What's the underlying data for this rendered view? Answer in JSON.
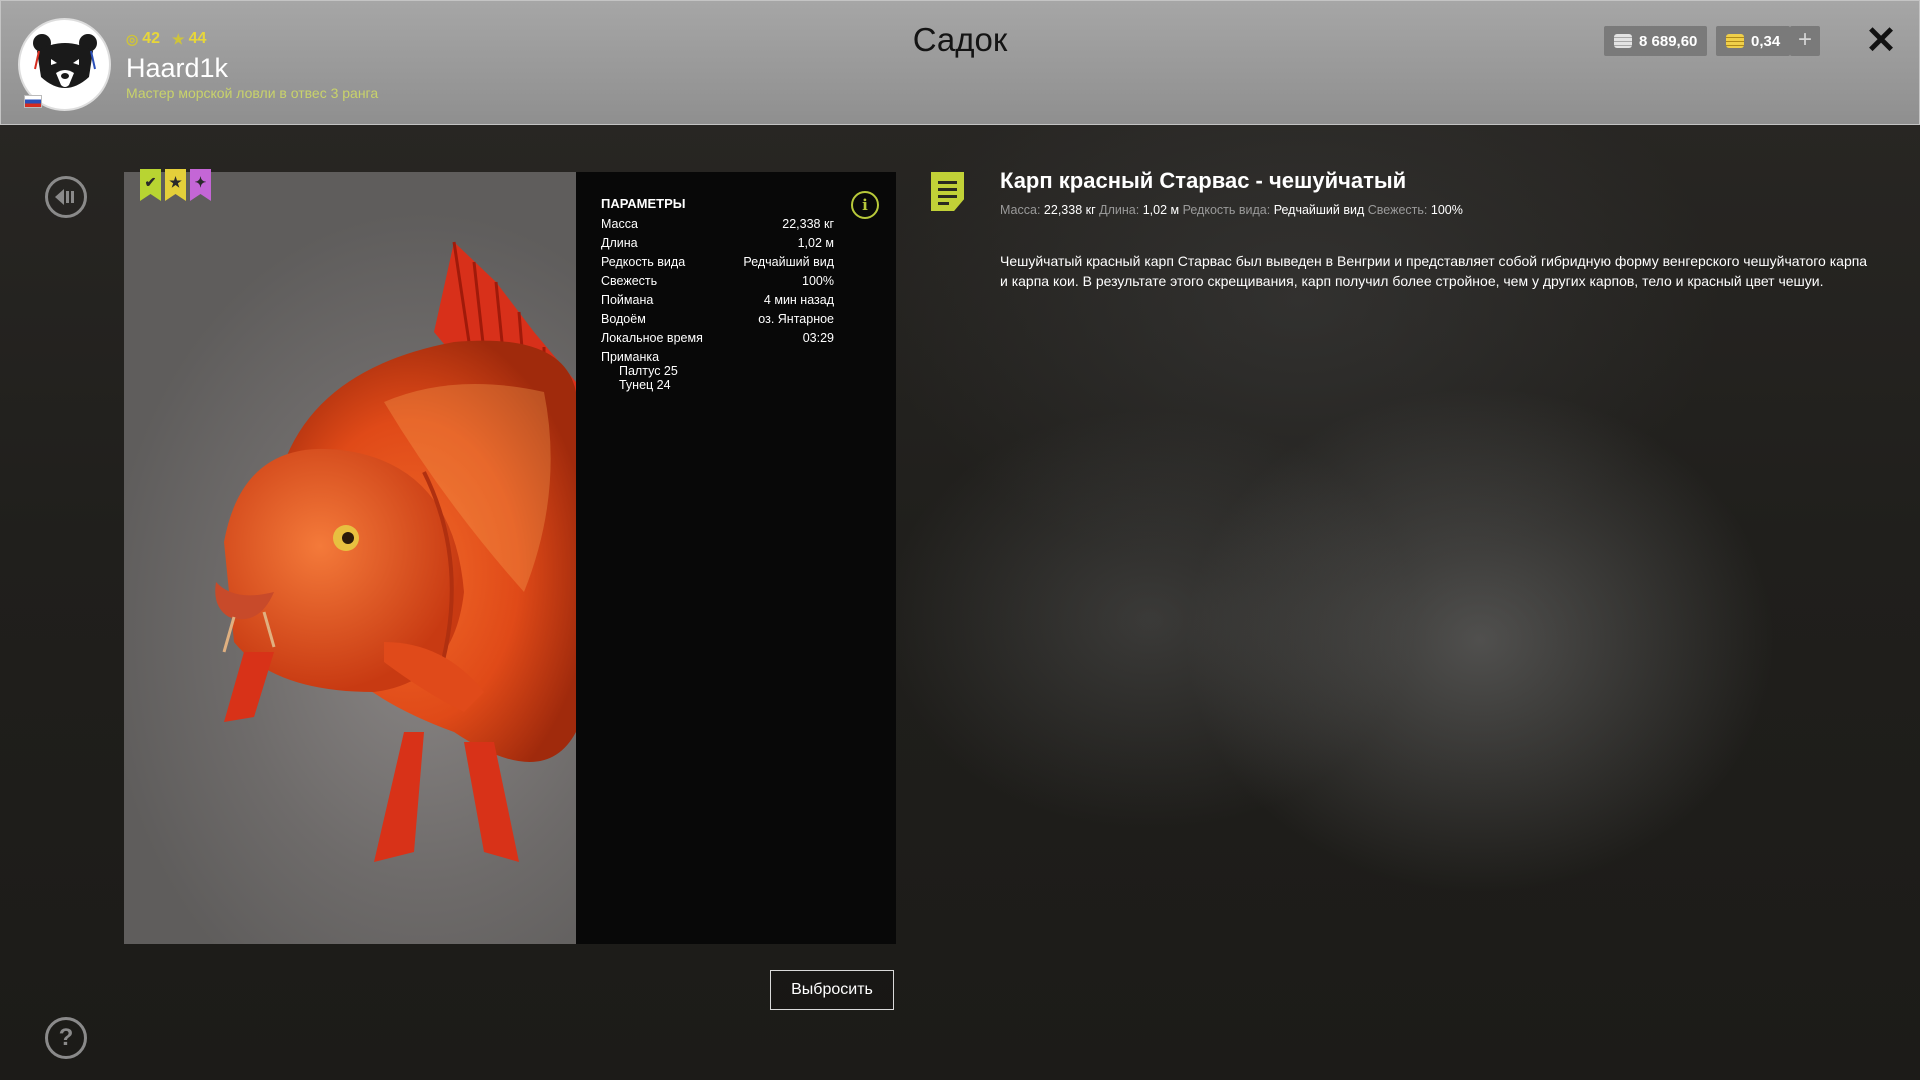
{
  "header": {
    "title": "Садок",
    "player": {
      "name": "Haard1k",
      "rank_text": "Мастер морской ловли в отвес 3 ранга",
      "level": "42",
      "stars": "44"
    },
    "silver": "8 689,60",
    "gold": "0,34",
    "add_label": "+",
    "close_label": "✕"
  },
  "params": {
    "title": "ПАРАМЕТРЫ",
    "rows": [
      {
        "label": "Масса",
        "value": "22,338 кг"
      },
      {
        "label": "Длина",
        "value": "1,02 м"
      },
      {
        "label": "Редкость вида",
        "value": "Редчайший вид"
      },
      {
        "label": "Свежесть",
        "value": "100%"
      },
      {
        "label": "Поймана",
        "value": "4 мин назад"
      },
      {
        "label": "Водоём",
        "value": "оз. Янтарное"
      },
      {
        "label": "Локальное время",
        "value": "03:29"
      }
    ],
    "bait_title": "Приманка",
    "baits": [
      "Палтус 25",
      "Тунец 24"
    ]
  },
  "fish": {
    "name": "Карп красный Старвас - чешуйчатый",
    "meta": {
      "mass_label": "Масса:",
      "mass": "22,338 кг",
      "length_label": "Длина:",
      "length": "1,02 м",
      "rarity_label": "Редкость вида:",
      "rarity": "Редчайший вид",
      "fresh_label": "Свежесть:",
      "fresh": "100%"
    },
    "description": "Чешуйчатый красный карп Старвас был выведен в Венгрии и представляет собой гибридную форму венгерского чешуйчатого карпа и карпа кои. В результате этого скрещивания, карп получил более стройное, чем у других карпов, тело и красный цвет чешуи."
  },
  "actions": {
    "release_label": "Выбросить"
  },
  "colors": {
    "accent": "#c1d137",
    "badge_green": "#b8d432",
    "badge_yellow": "#e4cf3a",
    "badge_purple": "#c466d6"
  },
  "icons": {
    "back": "back-arrow-icon",
    "help": "question-icon",
    "info": "info-icon",
    "doc": "document-icon"
  }
}
